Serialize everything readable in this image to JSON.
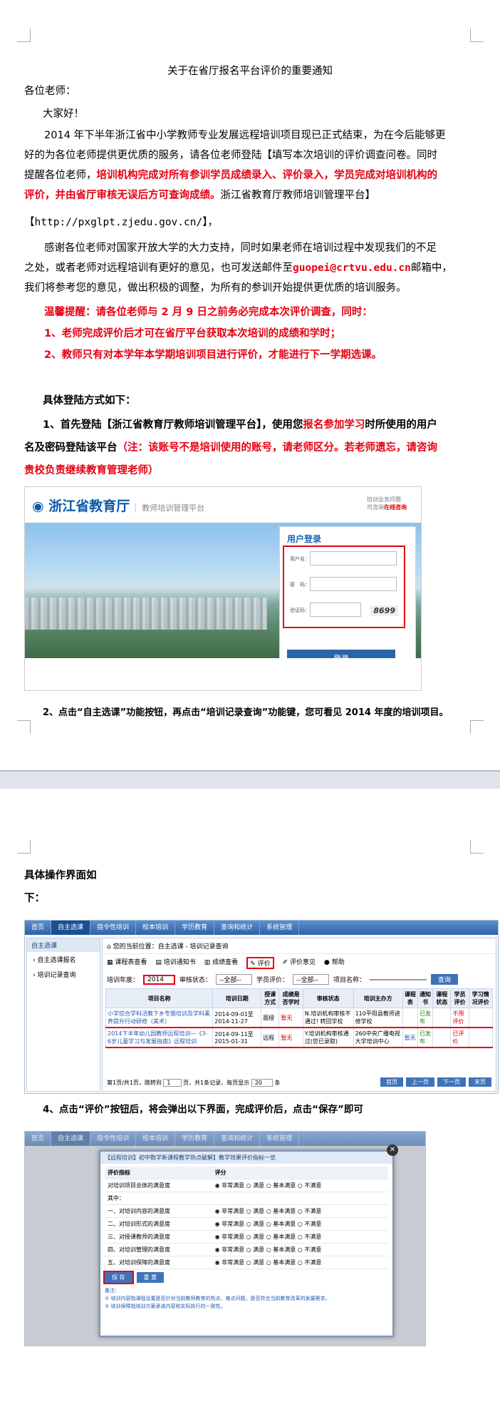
{
  "doc": {
    "title": "关于在省厅报名平台评价的重要通知",
    "greeting": "各位老师：",
    "hello": "大家好！",
    "para1_l1": "2014 年下半年浙江省中小学教师专业发展远程培训项目现已正式结束，为在今后能够更",
    "para1_l2": "好的为各位老师提供更优质的服务，请各位老师登陆【填写本次培训的评价调查问卷。同时",
    "para1_l3a": "提醒各位老师，",
    "para1_l3b": "培训机构完成对所有参训学员成绩录入、评价录入，学员完成对培训机构的",
    "para1_l4a": "评价，并由省厅审核无误后方可查询成绩。",
    "para1_l4b": "浙江省教育厅教师培训管理平台】",
    "url": "【http://pxglpt.zjedu.gov.cn/】，",
    "para2_l1": "感谢各位老师对国家开放大学的大力支持，同时如果老师在培训过程中发现我们的不足",
    "para2_l2a": "之处，或者老师对远程培训有更好的意见，也可发送邮件至",
    "email": "guopei@crtvu.edu.cn",
    "para2_l2b": "邮箱中，",
    "para2_l3": "我们将参考您的意见，做出积极的调整，为所有的参训开始提供更优质的培训服务。",
    "warm": "温馨提醒：请各位老师与 2 月 9 日之前务必完成本次评价调查，同时：",
    "warm1": "1、老师完成评价后才可在省厅平台获取本次培训的成绩和学时；",
    "warm2": "2、教师只有对本学年本学期培训项目进行评价，才能进行下一学期选课。",
    "login_head": "具体登陆方式如下：",
    "step1_l1a": "1、首先登陆【浙江省教育厅教师培训管理平台】，使用您",
    "step1_l1b": "报名参加学习",
    "step1_l1c": "时所使用的用户",
    "step1_l2a": "名及密码登陆该平台",
    "step1_l2b": "（注：该账号不是培训使用的账号，请老师区分。若老师遗忘，请咨询",
    "step1_l3": "贵校负责继续教育管理老师）",
    "step2": "2、点击“自主选课”功能按钮，再点击“培训记录查询”功能键，您可看见 2014 年度的培训项目。",
    "op_head_l1": "具体操作界面如",
    "op_head_l2": "下：",
    "step4": "4、点击“评价”按钮后，将会弹出以下界面，完成评价后，点击“保存”即可"
  },
  "login_shot": {
    "logo": "浙江省教育厅",
    "logo_sub": "教师培训管理平台",
    "help1": "培训业务问题",
    "help2": "可咨询",
    "help_link": "在线咨询",
    "login_title": "用户登录",
    "user_label": "用户名：",
    "pass_label": "密　码：",
    "code_label": "验证码：",
    "captcha": "8699",
    "login_btn": "登录"
  },
  "list_shot": {
    "nav": [
      "首页",
      "自主选课",
      "指令性培训",
      "校本培训",
      "学历教育",
      "查询和统计",
      "系统管理"
    ],
    "side_head": "自主选课",
    "side_items": [
      "自主选课报名",
      "培训记录查询"
    ],
    "crumb": "您的当前位置：自主选课 - 培训记录查询",
    "tools": [
      "课程表查看",
      "培训通知书",
      "成绩查看",
      "评价",
      "评价意见",
      "帮助"
    ],
    "year_label": "培训年度：",
    "year": "2014",
    "audit_label": "审核状态：",
    "audit_val": "--全部--",
    "score_label": "学员评价：",
    "score_val": "--全部--",
    "proj_label": "项目名称：",
    "query": "查询",
    "headers": [
      "项目名称",
      "培训日期",
      "授课方式",
      "成绩是否学时",
      "审核状态",
      "培训主办方",
      "课程表",
      "通知书",
      "课程状态",
      "学员评价",
      "学习情况评价"
    ],
    "rows": [
      [
        "小学综合学科活教下乡专题培训及学科素养提升行动研修（美术）",
        "2014-09-01至2014-11-27",
        "面授",
        "暂无",
        "N.培训机构审核不通过! 转回学校",
        "110平阳县教师进修学校",
        "",
        "已发布",
        "",
        "不用评价",
        ""
      ],
      [
        "2014下半年幼儿园教师远程培训—《3-6岁儿童学习与发展指南》远程培训",
        "2014-09-11至2015-01-31",
        "远程",
        "暂无",
        "Y.培训机构审核通过(您已录取)",
        "260中央广播电视大学培训中心",
        "暂无",
        "已发布",
        "",
        "已评价",
        ""
      ]
    ],
    "pager": "第1页/共1页，跳转到",
    "pager_page": "1",
    "pager_mid": "页，共1条记录，每页显示",
    "pager_size": "20",
    "pager_end": "条",
    "pbtns": [
      "首页",
      "上一页",
      "下一页",
      "末页"
    ]
  },
  "eval_shot": {
    "dlg_title": "【远程培训】初中数学新课程教学热点破解】教学效果评价指标一览",
    "col1": "评价指标",
    "col2": "评分",
    "intro": "对培训项目总体的满意度",
    "sub": "其中：",
    "items": [
      "一、对培训内容的满意度",
      "二、对培训形式的满意度",
      "三、对授课教师的满意度",
      "四、对培训管理的满意度",
      "五、对培训保障的满意度"
    ],
    "opts": [
      "非常满意",
      "满意",
      "基本满意",
      "不满意"
    ],
    "save": "保 存",
    "reset": "重 置",
    "note_h": "备注：",
    "note1": "① 培训内容指课程设置是否针对当前教师教育的热点、难点问题，是否符合当前教育改革的发展需求。",
    "note2": "② 培训保障指培训方案承诺内容和实际执行的一致性。"
  }
}
